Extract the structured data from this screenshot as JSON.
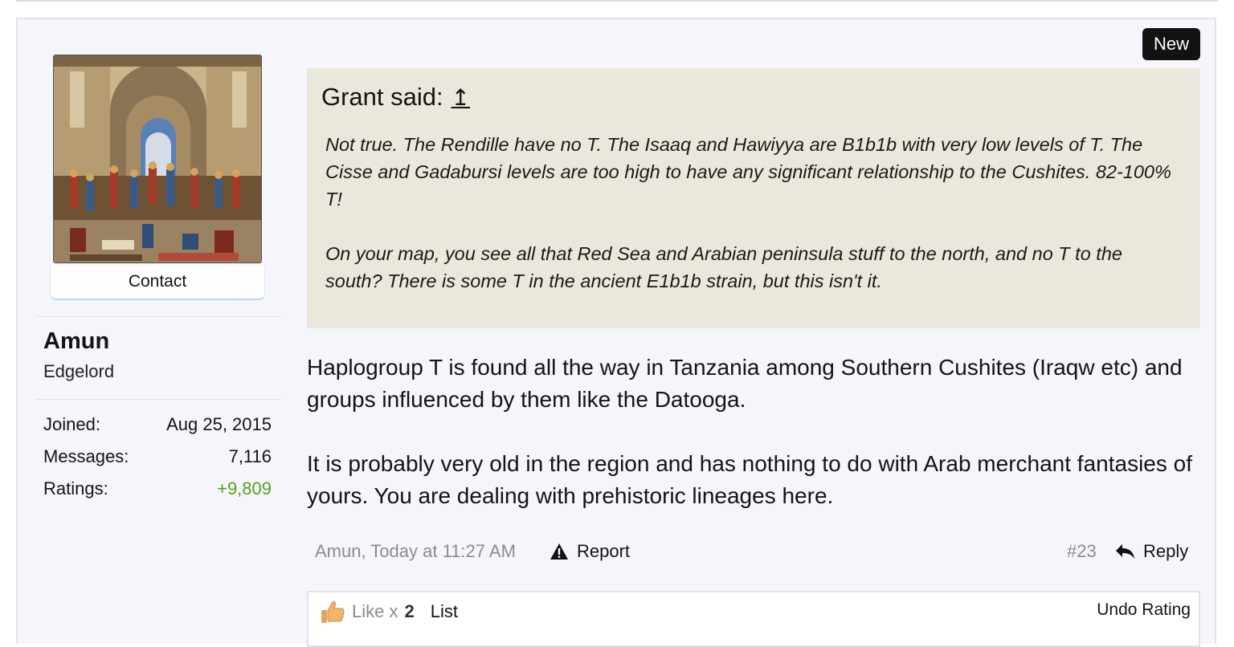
{
  "post": {
    "badge": "New",
    "author": {
      "contact_label": "Contact",
      "name": "Amun",
      "title": "Edgelord",
      "stats": [
        {
          "label": "Joined:",
          "value": "Aug 25, 2015"
        },
        {
          "label": "Messages:",
          "value": "7,116"
        },
        {
          "label": "Ratings:",
          "value": "+9,809"
        }
      ]
    },
    "quote": {
      "header": "Grant said:",
      "jump_glyph": "↥",
      "paragraphs": [
        "Not true. The Rendille have no T. The Isaaq and Hawiyya are B1b1b with very low levels of T. The Cisse and Gadabursi levels are too high to have any significant relationship to the Cushites. 82-100% T!",
        "On your map, you see all that Red Sea and Arabian peninsula stuff to the north, and no T to the south? There is some T in the ancient E1b1b strain, but this isn't it."
      ]
    },
    "body": [
      "Haplogroup T is found all the way in Tanzania among Southern Cushites (Iraqw etc) and groups influenced by them like the Datooga.",
      "It is probably very old in the region and has nothing to do with Arab merchant fantasies of yours. You are dealing with prehistoric lineages here."
    ],
    "footer": {
      "meta": "Amun, Today at 11:27 AM",
      "report": "Report",
      "post_number": "#23",
      "reply": "Reply"
    },
    "ratings": {
      "like_label": "Like x",
      "like_count": "2",
      "list_label": "List",
      "undo_label": "Undo Rating"
    },
    "colors": {
      "positive": "#5a9e1a",
      "quote_bg": "#eae8dc",
      "post_bg": "#f5f6fb"
    }
  }
}
